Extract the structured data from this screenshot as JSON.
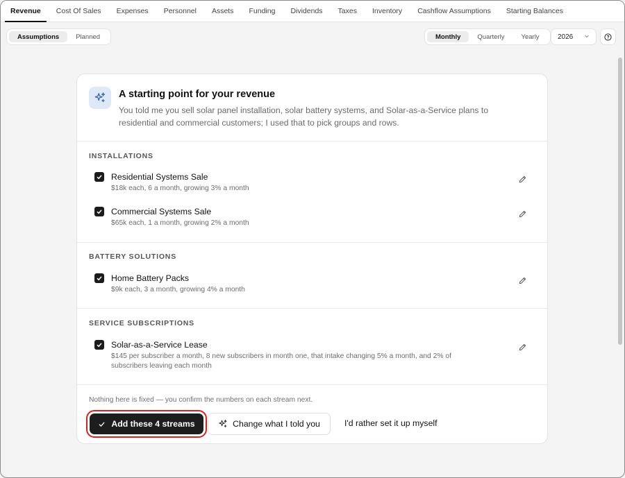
{
  "tabs": [
    {
      "label": "Revenue"
    },
    {
      "label": "Cost Of Sales"
    },
    {
      "label": "Expenses"
    },
    {
      "label": "Personnel"
    },
    {
      "label": "Assets"
    },
    {
      "label": "Funding"
    },
    {
      "label": "Dividends"
    },
    {
      "label": "Taxes"
    },
    {
      "label": "Inventory"
    },
    {
      "label": "Cashflow Assumptions"
    },
    {
      "label": "Starting Balances"
    }
  ],
  "view_toggle": {
    "assumptions": "Assumptions",
    "planned": "Planned"
  },
  "period_toggle": {
    "monthly": "Monthly",
    "quarterly": "Quarterly",
    "yearly": "Yearly"
  },
  "year_select": {
    "value": "2026"
  },
  "card": {
    "title": "A starting point for your revenue",
    "description": "You told me you sell solar panel installation, solar battery systems, and Solar-as-a-Service plans to residential and commercial customers; I used that to pick groups and rows.",
    "groups": [
      {
        "title": "INSTALLATIONS",
        "rows": [
          {
            "title": "Residential Systems Sale",
            "subtitle": "$18k each, 6 a month, growing 3% a month"
          },
          {
            "title": "Commercial Systems Sale",
            "subtitle": "$65k each, 1 a month, growing 2% a month"
          }
        ]
      },
      {
        "title": "BATTERY SOLUTIONS",
        "rows": [
          {
            "title": "Home Battery Packs",
            "subtitle": "$9k each, 3 a month, growing 4% a month"
          }
        ]
      },
      {
        "title": "SERVICE SUBSCRIPTIONS",
        "rows": [
          {
            "title": "Solar-as-a-Service Lease",
            "subtitle": "$145 per subscriber a month, 8 new subscribers in month one, that intake changing 5% a month, and 2% of subscribers leaving each month"
          }
        ]
      }
    ],
    "footnote": "Nothing here is fixed — you confirm the numbers on each stream next.",
    "primary_button": "Add these 4 streams",
    "secondary_button": "Change what I told you",
    "link_button": "I'd rather set it up myself"
  },
  "colors": {
    "accent_outline": "#d9201f",
    "primary_bg": "#1d1d1d",
    "icon_bg": "#dde9f8",
    "icon_stroke": "#2b5fa8"
  }
}
